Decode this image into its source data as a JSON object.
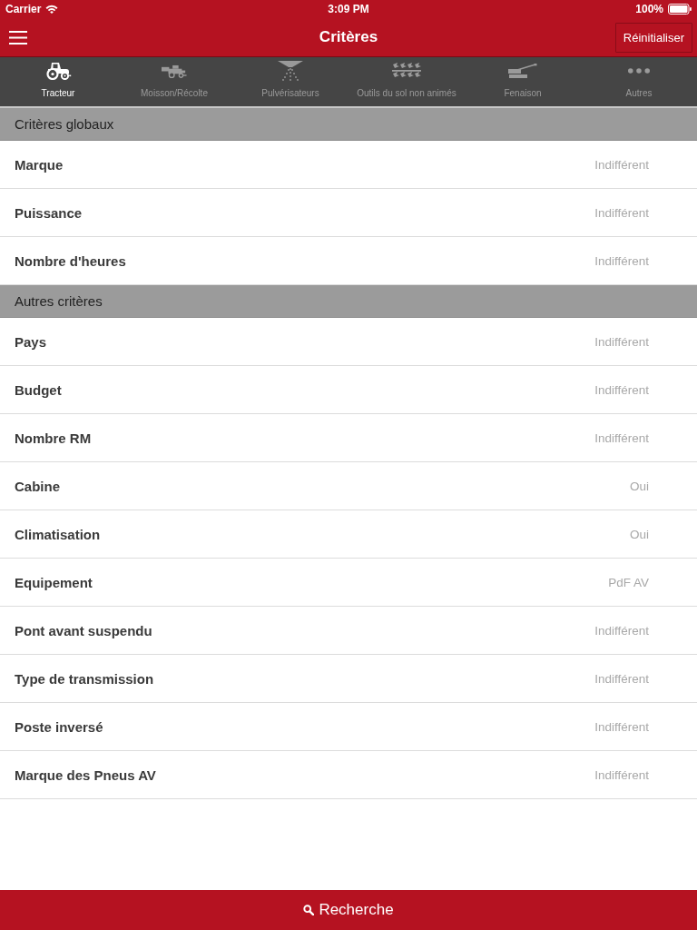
{
  "status_bar": {
    "carrier": "Carrier",
    "time": "3:09 PM",
    "battery": "100%"
  },
  "nav_bar": {
    "title": "Critères",
    "reset_button": "Réinitialiser"
  },
  "categories": [
    {
      "label": "Tracteur",
      "kind": "tractor",
      "selected": true
    },
    {
      "label": "Moisson/Récolte",
      "kind": "combine",
      "selected": false
    },
    {
      "label": "Pulvérisateurs",
      "kind": "sprayer",
      "selected": false
    },
    {
      "label": "Outils du sol non animés",
      "kind": "plough",
      "selected": false
    },
    {
      "label": "Fenaison",
      "kind": "hay",
      "selected": false
    },
    {
      "label": "Autres",
      "kind": "more",
      "selected": false
    }
  ],
  "sections": [
    {
      "title": "Critères globaux",
      "rows": [
        {
          "label": "Marque",
          "value": "Indifférent"
        },
        {
          "label": "Puissance",
          "value": "Indifférent"
        },
        {
          "label": "Nombre d'heures",
          "value": "Indifférent"
        }
      ]
    },
    {
      "title": "Autres critères",
      "rows": [
        {
          "label": "Pays",
          "value": "Indifférent"
        },
        {
          "label": "Budget",
          "value": "Indifférent"
        },
        {
          "label": "Nombre RM",
          "value": "Indifférent"
        },
        {
          "label": "Cabine",
          "value": "Oui"
        },
        {
          "label": "Climatisation",
          "value": "Oui"
        },
        {
          "label": "Equipement",
          "value": "PdF AV"
        },
        {
          "label": "Pont avant suspendu",
          "value": "Indifférent"
        },
        {
          "label": "Type de transmission",
          "value": "Indifférent"
        },
        {
          "label": "Poste inversé",
          "value": "Indifférent"
        },
        {
          "label": "Marque des Pneus AV",
          "value": "Indifférent"
        }
      ]
    }
  ],
  "search_button": {
    "label": "Recherche"
  }
}
